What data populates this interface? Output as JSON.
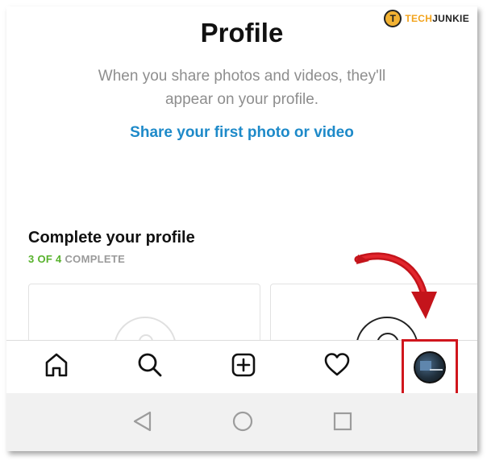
{
  "watermark": {
    "badge": "T",
    "part1": "TECH",
    "part2": "JUNKIE"
  },
  "header": {
    "title": "Profile"
  },
  "empty_state": {
    "description": "When you share photos and videos, they'll appear on your profile.",
    "cta": "Share your first photo or video"
  },
  "complete_profile": {
    "title": "Complete your profile",
    "progress_count": "3 OF 4",
    "progress_label": "COMPLETE"
  },
  "bottom_nav": {
    "items": [
      {
        "name": "home",
        "icon": "home-icon"
      },
      {
        "name": "search",
        "icon": "search-icon"
      },
      {
        "name": "new-post",
        "icon": "add-post-icon"
      },
      {
        "name": "activity",
        "icon": "heart-icon"
      },
      {
        "name": "profile",
        "icon": "avatar"
      }
    ]
  },
  "colors": {
    "link_blue": "#1e8ac9",
    "progress_green": "#58b22d",
    "highlight_red": "#d0161d"
  }
}
